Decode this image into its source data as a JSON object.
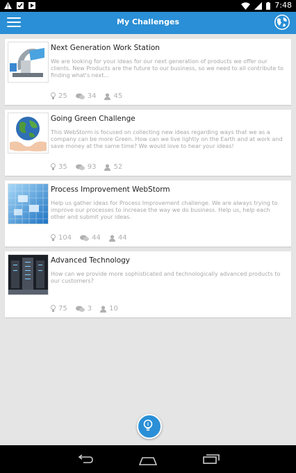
{
  "status_bar": {
    "time": "7:48",
    "icons": [
      "warning-icon",
      "check-box-icon",
      "media-icon",
      "wifi-icon",
      "signal-icon",
      "battery-icon"
    ]
  },
  "app_bar": {
    "title": "My Challenges",
    "menu_icon": "menu-icon",
    "globe_icon": "globe-icon",
    "color": "#2a8fd6"
  },
  "challenges": [
    {
      "title": "Next Generation Work Station",
      "description": "We are looking for your ideas for our next generation of products we offer our clients. New Products are the future to our business, so we need to all contribute to finding what's next...",
      "ideas": "25",
      "comments": "34",
      "participants": "45",
      "image": "workstation-image"
    },
    {
      "title": "Going Green Challenge",
      "description": "This WebStorm is focused on collecting new ideas regarding ways that we as a company can be more Green.  How can we live lightly on the Earth and at work and save money at the same time? We would love to hear your ideas!",
      "ideas": "35",
      "comments": "93",
      "participants": "52",
      "image": "globe-in-hands-image"
    },
    {
      "title": "Process Improvement WebStorm",
      "description": "Help us gather ideas for Process Improvement challenge.  We are always trying to improve our processes to increase the way we do business. Help us, help each other and submit your ideas.",
      "ideas": "104",
      "comments": "44",
      "participants": "44",
      "image": "process-image"
    },
    {
      "title": "Advanced Technology",
      "description": "How can we provide more sophisticated and technologically advanced products to our customers?",
      "ideas": "75",
      "comments": "3",
      "participants": "10",
      "image": "server-room-image"
    }
  ],
  "fab": {
    "icon": "lightbulb-icon"
  },
  "nav_bar": {
    "buttons": [
      "back-icon",
      "home-icon",
      "recents-icon"
    ]
  }
}
